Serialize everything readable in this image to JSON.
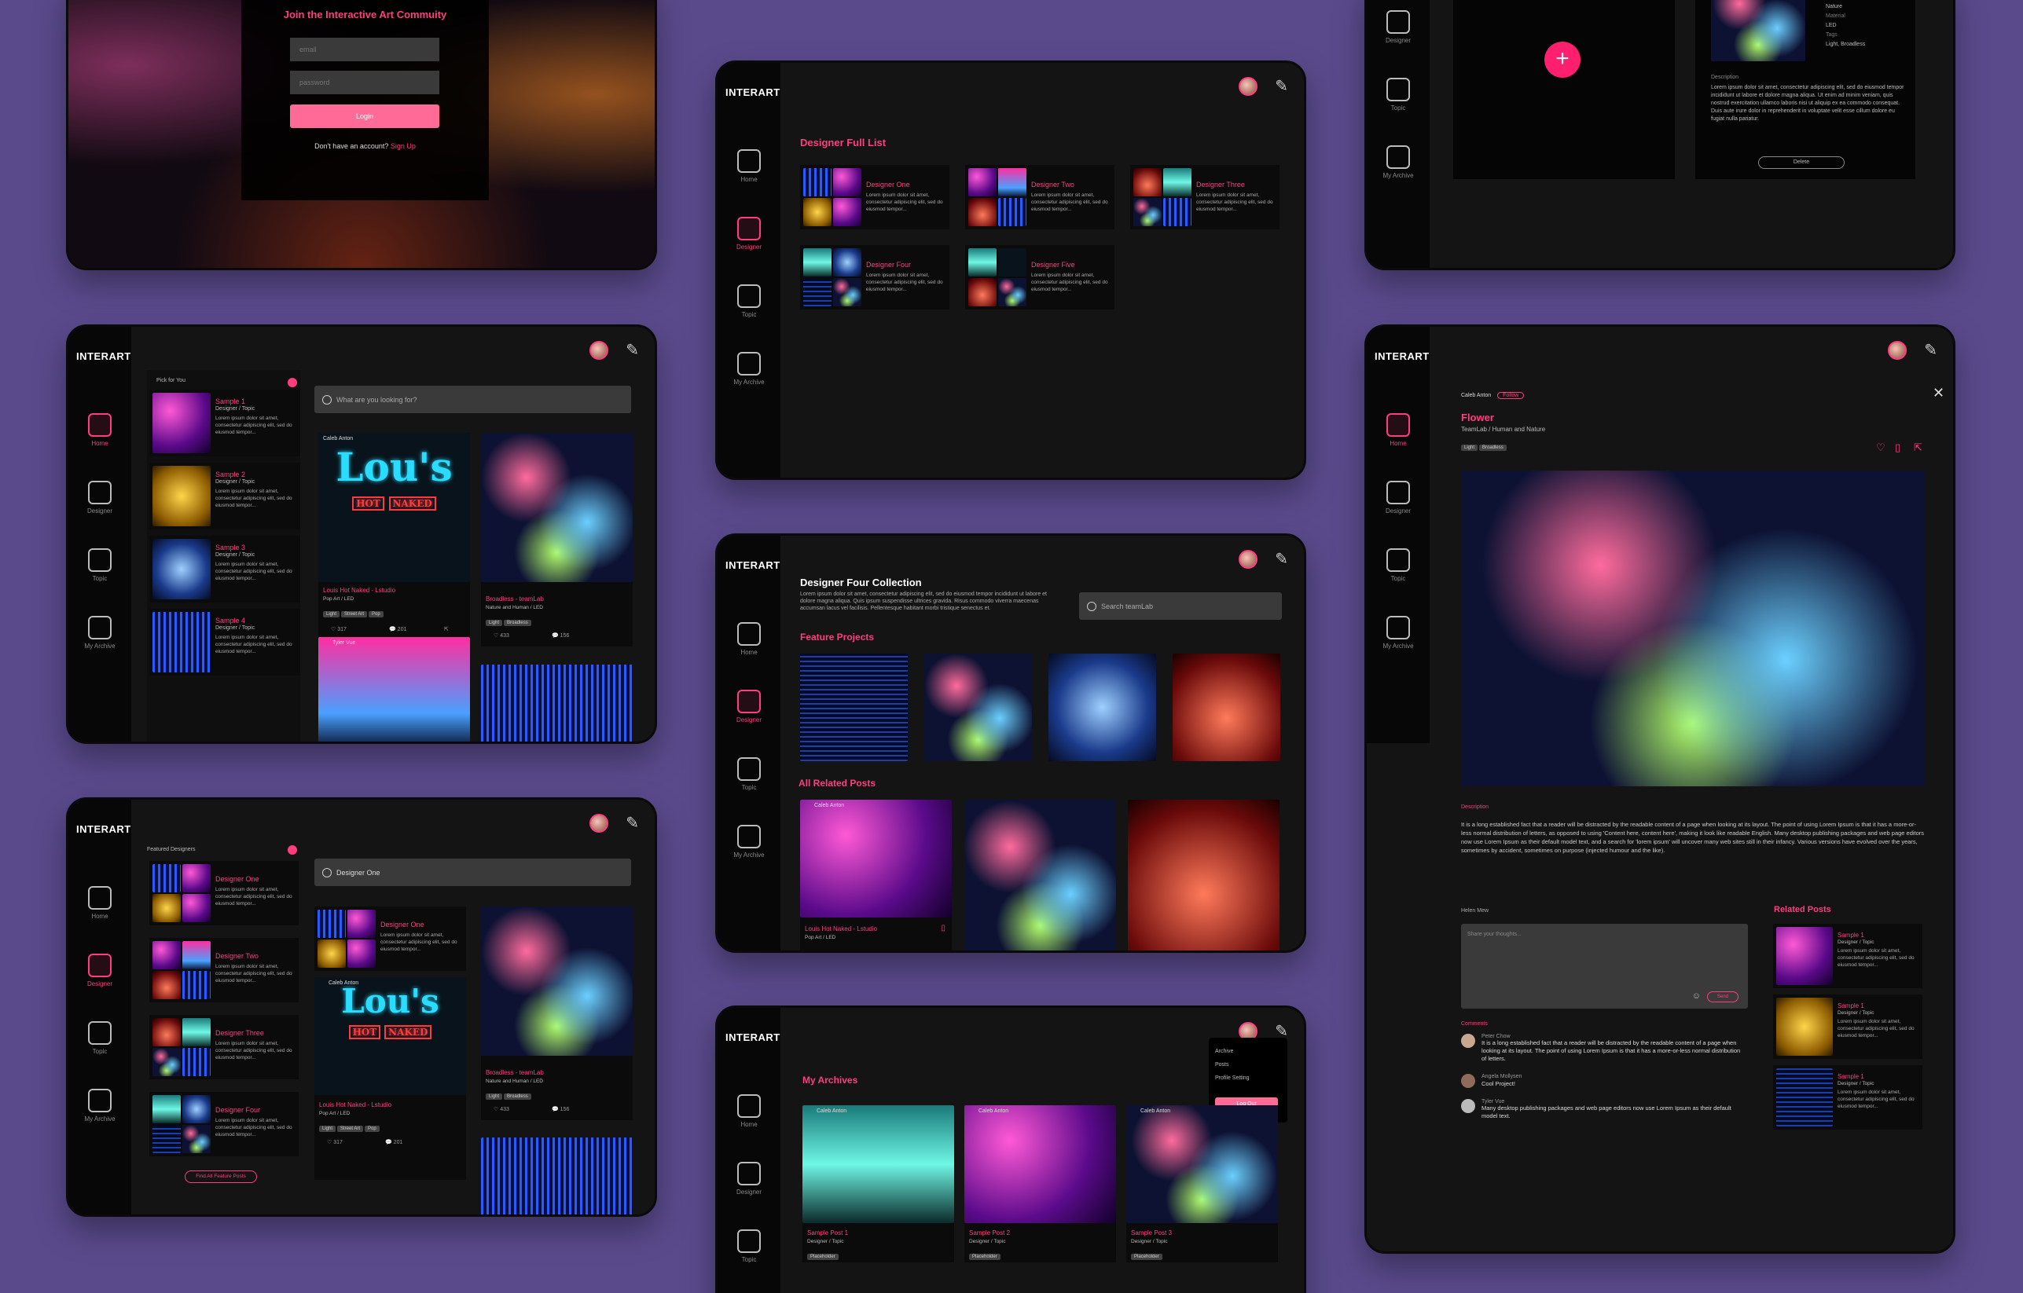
{
  "brand": "INTERART",
  "login": {
    "title": "Join the Interactive Art Commuity",
    "email_placeholder": "email",
    "password_placeholder": "password",
    "button": "Login",
    "signup_prompt": "Don't have an account?",
    "signup_link": "Sign Up"
  },
  "nav": {
    "home": "Home",
    "designer": "Designer",
    "topic": "Topic",
    "archive": "My Archive"
  },
  "lorem_short": "Lorem ipsum dolor sit amet, consectetur adipiscing elit, sed do eiusmod tempor...",
  "designer_list": {
    "title": "Designer Full List",
    "items": [
      "Designer One",
      "Designer Two",
      "Designer Three",
      "Designer Four",
      "Designer Five"
    ]
  },
  "home": {
    "pick_title": "Pick for You",
    "search_placeholder": "What are you looking for?",
    "picks": [
      {
        "title": "Sample 1",
        "sub": "Designer / Topic"
      },
      {
        "title": "Sample 2",
        "sub": "Designer / Topic"
      },
      {
        "title": "Sample 3",
        "sub": "Designer / Topic"
      },
      {
        "title": "Sample 4",
        "sub": "Designer / Topic"
      }
    ],
    "post1": {
      "author": "Caleb Anton",
      "title": "Louis Hot Naked - Lstudio",
      "sub": "Pop Art / LED",
      "tags": [
        "Light",
        "Street Art",
        "Pop"
      ],
      "likes": "317",
      "comments": "201"
    },
    "post2": {
      "title": "Broadless - teamLab",
      "sub": "Nature and Human / LED",
      "tags": [
        "Light",
        "Broadless"
      ],
      "likes": "433",
      "comments": "156"
    },
    "post3": {
      "author": "Tyler Vue"
    },
    "neon_line1": "Lou's",
    "neon_w1": "HOT",
    "neon_w2": "NAKED"
  },
  "featured": {
    "title": "Featured Designers",
    "search_value": "Designer One",
    "items": [
      "Designer One",
      "Designer Two",
      "Designer Three",
      "Designer Four"
    ],
    "more": "Find All Feature Posts",
    "post_designer": "Designer One"
  },
  "collection": {
    "title": "Designer Four Collection",
    "desc": "Lorem ipsum dolor sit amet, consectetur adipiscing elit, sed do eiusmod tempor incididunt ut labore et dolore magna aliqua. Quis ipsum suspendisse ultrices gravida. Risus commodo viverra maecenas accumsan lacus vel facilisis. Pellentesque habitant morbi tristique senectus et.",
    "search_placeholder": "Search teamLab",
    "feature_title": "Feature Projects",
    "related_title": "All Related Posts",
    "related_post": {
      "author": "Caleb Anton",
      "title": "Louis Hot Naked - Lstudio",
      "sub": "Pop Art / LED"
    }
  },
  "archives": {
    "title": "My Archives",
    "menu": [
      "Archive",
      "Posts",
      "Profile Setting"
    ],
    "logout": "Log Out",
    "posts": [
      {
        "author": "Caleb Anton",
        "title": "Sample Post 1",
        "sub": "Designer / Topic",
        "tag": "Placeholder"
      },
      {
        "author": "Caleb Anton",
        "title": "Sample Post 2",
        "sub": "Designer / Topic",
        "tag": "Placeholder"
      },
      {
        "author": "Caleb Anton",
        "title": "Sample Post 3",
        "sub": "Designer / Topic",
        "tag": "Placeholder"
      }
    ]
  },
  "upload": {
    "field_labels": [
      "Nature",
      "Material",
      "LED",
      "Tags",
      "Light, Broadless"
    ],
    "desc_label": "Description",
    "desc": "Lorem ipsum dolor sit amet, consectetur adipiscing elit, sed do eiusmod tempor incididunt ut labore et dolore magna aliqua. Ut enim ad minim veniam, quis nostrud exercitation ullamco laboris nisi ut aliquip ex ea commodo consequat. Duis aute irure dolor in reprehenderit in voluptate velit esse cillum dolore eu fugiat nulla pariatur.",
    "delete": "Delete"
  },
  "detail": {
    "author": "Caleb Anton",
    "follow": "Follow",
    "title": "Flower",
    "sub": "TeamLab / Human and Nature",
    "tags": [
      "Light",
      "Broadless"
    ],
    "desc_label": "Description",
    "desc": "It is a long established fact that a reader will be distracted by the readable content of a page when looking at its layout. The point of using Lorem Ipsum is that it has a more-or-less normal distribution of letters, as opposed to using 'Content here, content here', making it look like readable English. Many desktop publishing packages and web page editors now use Lorem Ipsum as their default model text, and a search for 'lorem ipsum' will uncover many web sites still in their infancy. Various versions have evolved over the years, sometimes by accident, sometimes on purpose (injected humour and the like).",
    "commenter": "Helen Mew",
    "comment_placeholder": "Share your thoughts...",
    "send": "Send",
    "comments_label": "Comments",
    "comments": [
      {
        "name": "Peter Chow",
        "text": "It is a long established fact that a reader will be distracted by the readable content of a page when looking at its layout. The point of using Lorem Ipsum is that it has a more-or-less normal distribution of letters."
      },
      {
        "name": "Angela Mollysen",
        "text": "Cool Project!"
      },
      {
        "name": "Tyler Vue",
        "text": "Many desktop publishing packages and web page editors now use Lorem Ipsum as their default model text."
      }
    ],
    "related_title": "Related Posts",
    "related": [
      {
        "title": "Sample 1",
        "sub": "Designer / Topic"
      },
      {
        "title": "Sample 1",
        "sub": "Designer / Topic"
      },
      {
        "title": "Sample 1",
        "sub": "Designer / Topic"
      }
    ]
  }
}
